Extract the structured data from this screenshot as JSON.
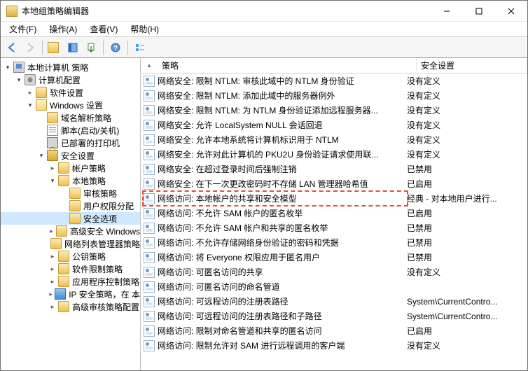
{
  "window": {
    "title": "本地组策略编辑器"
  },
  "menu": {
    "file": "文件(F)",
    "action": "操作(A)",
    "view": "查看(V)",
    "help": "帮助(H)"
  },
  "toolbar_icons": {
    "back": "back-arrow",
    "forward": "forward-arrow",
    "up": "folder-up",
    "properties": "properties",
    "export": "export-list",
    "help": "help",
    "category": "view-category"
  },
  "tree": [
    {
      "depth": 0,
      "exp": "open",
      "icon": "computer",
      "label": "本地计算机 策略"
    },
    {
      "depth": 1,
      "exp": "open",
      "icon": "gear",
      "label": "计算机配置"
    },
    {
      "depth": 2,
      "exp": "closed",
      "icon": "folder",
      "label": "软件设置"
    },
    {
      "depth": 2,
      "exp": "open",
      "icon": "folder-open",
      "label": "Windows 设置"
    },
    {
      "depth": 3,
      "exp": "none",
      "icon": "folder",
      "label": "域名解析策略"
    },
    {
      "depth": 3,
      "exp": "none",
      "icon": "script",
      "label": "脚本(启动/关机)"
    },
    {
      "depth": 3,
      "exp": "none",
      "icon": "printer",
      "label": "已部署的打印机"
    },
    {
      "depth": 3,
      "exp": "open",
      "icon": "lock",
      "label": "安全设置"
    },
    {
      "depth": 4,
      "exp": "closed",
      "icon": "folder",
      "label": "帐户策略"
    },
    {
      "depth": 4,
      "exp": "open",
      "icon": "folder",
      "label": "本地策略"
    },
    {
      "depth": 5,
      "exp": "none",
      "icon": "folder",
      "label": "审核策略"
    },
    {
      "depth": 5,
      "exp": "none",
      "icon": "folder",
      "label": "用户权限分配"
    },
    {
      "depth": 5,
      "exp": "none",
      "icon": "folder",
      "label": "安全选项",
      "selected": true
    },
    {
      "depth": 4,
      "exp": "closed",
      "icon": "folder",
      "label": "高级安全 Windows"
    },
    {
      "depth": 4,
      "exp": "none",
      "icon": "folder",
      "label": "网络列表管理器策略"
    },
    {
      "depth": 4,
      "exp": "closed",
      "icon": "folder",
      "label": "公钥策略"
    },
    {
      "depth": 4,
      "exp": "closed",
      "icon": "folder",
      "label": "软件限制策略"
    },
    {
      "depth": 4,
      "exp": "closed",
      "icon": "folder",
      "label": "应用程序控制策略"
    },
    {
      "depth": 4,
      "exp": "closed",
      "icon": "book",
      "label": "IP 安全策略，在 本"
    },
    {
      "depth": 4,
      "exp": "closed",
      "icon": "folder",
      "label": "高级审核策略配置"
    }
  ],
  "columns": {
    "policy": "策略",
    "setting": "安全设置"
  },
  "rows": [
    {
      "policy": "网络安全: 限制 NTLM: 审核此域中的 NTLM 身份验证",
      "setting": "没有定义"
    },
    {
      "policy": "网络安全: 限制 NTLM: 添加此域中的服务器例外",
      "setting": "没有定义"
    },
    {
      "policy": "网络安全: 限制 NTLM: 为 NTLM 身份验证添加远程服务器...",
      "setting": "没有定义"
    },
    {
      "policy": "网络安全: 允许 LocalSystem NULL 会话回退",
      "setting": "没有定义"
    },
    {
      "policy": "网络安全: 允许本地系统将计算机标识用于 NTLM",
      "setting": "没有定义"
    },
    {
      "policy": "网络安全: 允许对此计算机的 PKU2U 身份验证请求使用联...",
      "setting": "没有定义"
    },
    {
      "policy": "网络安全: 在超过登录时间后强制注销",
      "setting": "已禁用"
    },
    {
      "policy": "网络安全: 在下一次更改密码时不存储 LAN 管理器哈希值",
      "setting": "已启用"
    },
    {
      "policy": "网络访问: 本地帐户的共享和安全模型",
      "setting": "经典 - 对本地用户进行...",
      "highlighted": true
    },
    {
      "policy": "网络访问: 不允许 SAM 帐户的匿名枚举",
      "setting": "已启用"
    },
    {
      "policy": "网络访问: 不允许 SAM 帐户和共享的匿名枚举",
      "setting": "已禁用"
    },
    {
      "policy": "网络访问: 不允许存储网络身份验证的密码和凭据",
      "setting": "已禁用"
    },
    {
      "policy": "网络访问: 将 Everyone 权限应用于匿名用户",
      "setting": "已禁用"
    },
    {
      "policy": "网络访问: 可匿名访问的共享",
      "setting": "没有定义"
    },
    {
      "policy": "网络访问: 可匿名访问的命名管道",
      "setting": ""
    },
    {
      "policy": "网络访问: 可远程访问的注册表路径",
      "setting": "System\\CurrentContro..."
    },
    {
      "policy": "网络访问: 可远程访问的注册表路径和子路径",
      "setting": "System\\CurrentContro..."
    },
    {
      "policy": "网络访问: 限制对命名管道和共享的匿名访问",
      "setting": "已启用"
    },
    {
      "policy": "网络访问: 限制允许对 SAM 进行远程调用的客户端",
      "setting": "没有定义"
    }
  ]
}
